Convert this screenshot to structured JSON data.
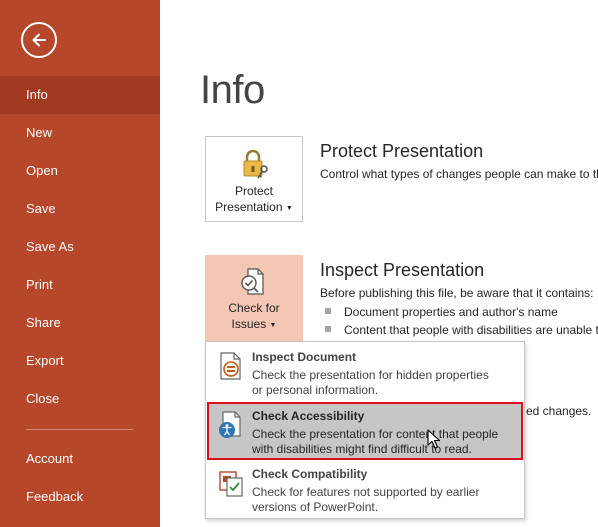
{
  "sidebar": {
    "back_label": "Back",
    "items": [
      {
        "label": "Info",
        "active": true
      },
      {
        "label": "New"
      },
      {
        "label": "Open"
      },
      {
        "label": "Save"
      },
      {
        "label": "Save As"
      },
      {
        "label": "Print"
      },
      {
        "label": "Share"
      },
      {
        "label": "Export"
      },
      {
        "label": "Close"
      },
      {
        "label": "Account"
      },
      {
        "label": "Feedback"
      }
    ]
  },
  "main": {
    "title": "Info",
    "protect": {
      "button_line1": "Protect",
      "button_line2": "Presentation",
      "heading": "Protect Presentation",
      "description": "Control what types of changes people can make to this presentation."
    },
    "inspect": {
      "button_line1": "Check for",
      "button_line2": "Issues",
      "heading": "Inspect Presentation",
      "description": "Before publishing this file, be aware that it contains:",
      "bullets": [
        "Document properties and author's name",
        "Content that people with disabilities are unable to read"
      ],
      "partial_text": "ed changes."
    }
  },
  "dropdown": {
    "items": [
      {
        "title": "Inspect Document",
        "desc_line1": "Check the presentation for hidden properties",
        "desc_line2": "or personal information.",
        "icon": "inspect-document-icon"
      },
      {
        "title": "Check Accessibility",
        "desc_line1": "Check the presentation for content that people",
        "desc_line2": "with disabilities might find difficult to read.",
        "icon": "accessibility-icon",
        "selected": true
      },
      {
        "title": "Check Compatibility",
        "desc_line1": "Check for features not supported by earlier",
        "desc_line2": "versions of PowerPoint.",
        "icon": "compatibility-icon"
      }
    ]
  },
  "colors": {
    "sidebar_bg": "#b7472a",
    "sidebar_active": "#a0391f",
    "highlight_tile": "#f4c7b5",
    "selection_border": "#d9111d"
  }
}
